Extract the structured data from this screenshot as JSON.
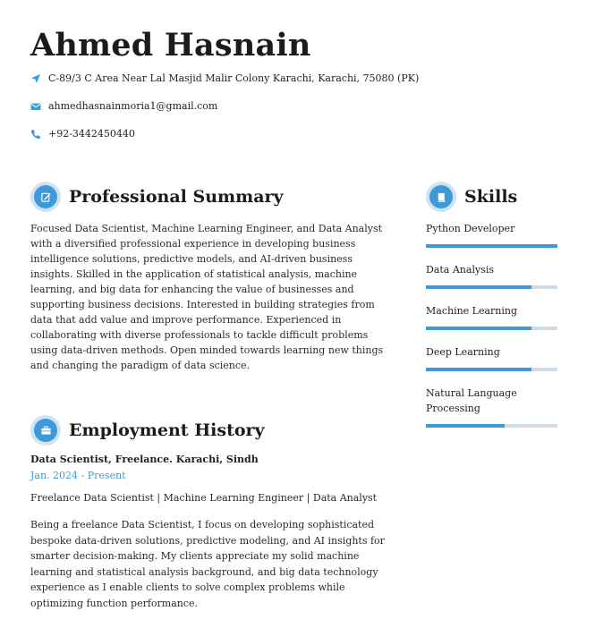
{
  "header": {
    "name": "Ahmed Hasnain",
    "address": "C-89/3 C Area Near Lal Masjid Malir Colony Karachi, Karachi, 75080 (PK)",
    "email": "ahmedhasnainmoria1@gmail.com",
    "phone": "+92-3442450440",
    "icons": [
      "location-arrow-icon",
      "envelope-icon",
      "phone-icon"
    ]
  },
  "summary": {
    "title": "Professional Summary",
    "text": "Focused Data Scientist, Machine Learning Engineer, and Data Analyst with a diversified professional experience in developing business intelligence solutions, predictive models, and AI-driven business insights. Skilled in the application of statistical analysis, machine learning, and big data for enhancing the value of businesses and supporting business decisions. Interested in building strategies from data that add value and improve performance. Experienced in collaborating with diverse professionals to tackle difficult problems using data-driven methods. Open minded towards learning new things and changing the paradigm of data science."
  },
  "employment": {
    "title": "Employment History",
    "job_title": "Data Scientist, Freelance. Karachi, Sindh",
    "dates": "Jan. 2024 - Present",
    "subtitle": "Freelance Data Scientist | Machine Learning Engineer | Data Analyst",
    "description": "Being a freelance Data Scientist, I focus on developing sophisticated bespoke data-driven solutions, predictive modeling, and AI insights for smarter decision-making. My clients appreciate my solid machine learning and statistical analysis background, and big data technology experience as I enable clients to solve complex problems while optimizing function performance."
  },
  "skills": {
    "title": "Skills",
    "items": [
      {
        "label": "Python Developer",
        "level": 1.0
      },
      {
        "label": "Data Analysis",
        "level": 0.8
      },
      {
        "label": "Machine Learning",
        "level": 0.8
      },
      {
        "label": "Deep Learning",
        "level": 0.8
      },
      {
        "label": "Natural Language Processing",
        "level": 0.6
      }
    ]
  },
  "colors": {
    "accent": "#3d9ad8",
    "bar_track": "#d3dbe2",
    "badge_ring": "#cfe3f3"
  }
}
